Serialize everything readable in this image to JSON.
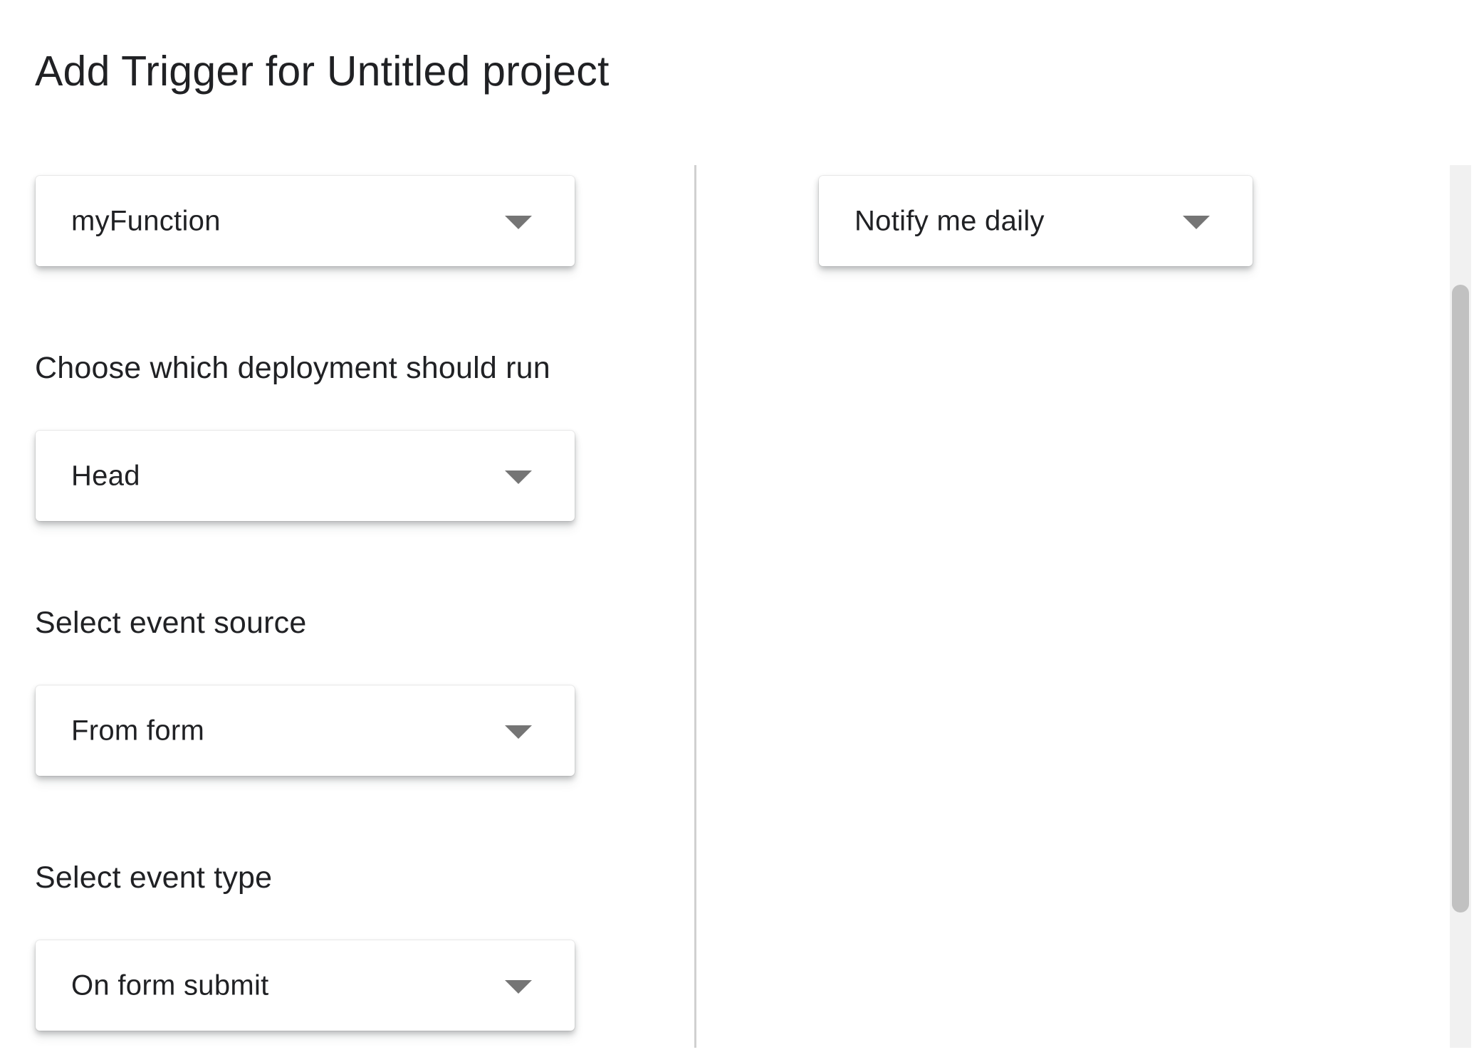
{
  "dialog": {
    "title": "Add Trigger for Untitled project"
  },
  "left_column": {
    "function_select": {
      "value": "myFunction"
    },
    "deployment": {
      "label": "Choose which deployment should run",
      "value": "Head"
    },
    "event_source": {
      "label": "Select event source",
      "value": "From form"
    },
    "event_type": {
      "label": "Select event type",
      "value": "On form submit"
    }
  },
  "right_column": {
    "failure_notification_select": {
      "value": "Notify me daily"
    }
  },
  "icons": {
    "dropdown": "caret-down-icon"
  },
  "colors": {
    "text": "#202124",
    "caret": "#757575",
    "divider": "#d0d0d0",
    "scrollbar_thumb": "#c1c1c1"
  }
}
